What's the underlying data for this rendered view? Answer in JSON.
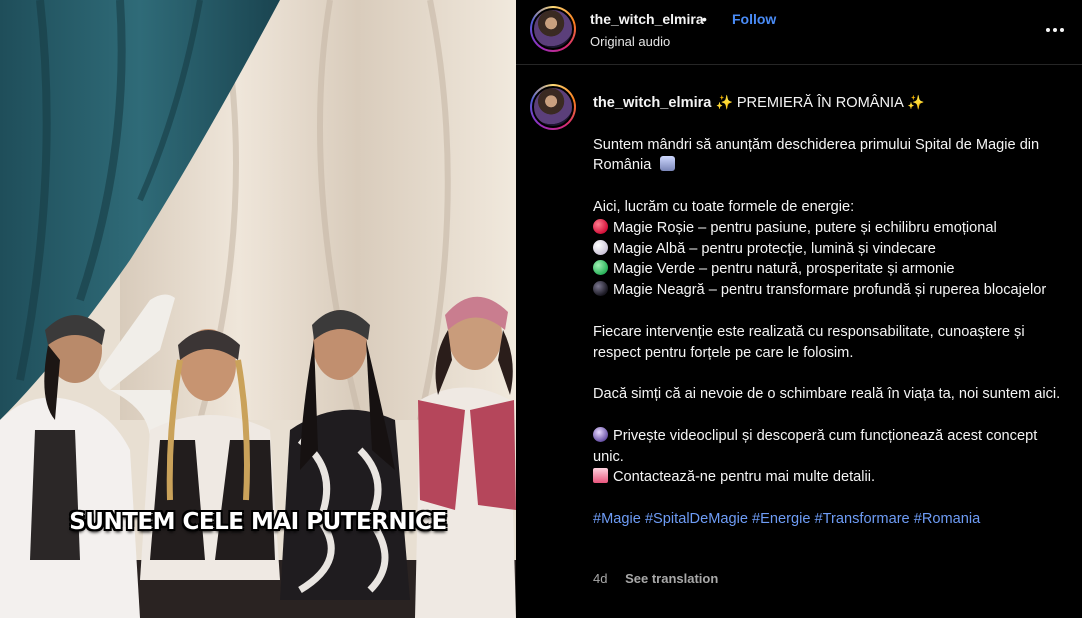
{
  "media": {
    "caption_overlay": "SUNTEM CELE MAI PUTERNICE"
  },
  "header": {
    "username": "the_witch_elmira",
    "separator": "•",
    "follow_label": "Follow",
    "audio_label": "Original audio"
  },
  "comment": {
    "username": "the_witch_elmira",
    "title": "PREMIERĂ ÎN ROMÂNIA",
    "intro": "Suntem mândri să anunțăm deschiderea primului Spital de Magie din România",
    "energies_heading": "Aici, lucrăm cu toate formele de energie:",
    "energies": [
      {
        "icon": "red-circle-icon",
        "text": "Magie Roșie – pentru pasiune, putere și echilibru emoțional"
      },
      {
        "icon": "white-circle-icon",
        "text": "Magie Albă – pentru protecție, lumină și vindecare"
      },
      {
        "icon": "green-circle-icon",
        "text": "Magie Verde – pentru natură, prosperitate și armonie"
      },
      {
        "icon": "black-circle-icon",
        "text": "Magie Neagră – pentru transformare profundă și ruperea blocajelor"
      }
    ],
    "responsibility": "Fiecare intervenție este realizată cu responsabilitate, cunoaștere și respect pentru forțele pe care le folosim.",
    "help": "Dacă simți că ai nevoie de o schimbare reală în viața ta, noi suntem aici.",
    "watch": "Privește videoclipul și descoperă cum funcționează acest concept unic.",
    "contact": "Contactează-ne pentru mai multe detalii.",
    "hashtags": [
      "#Magie",
      "#SpitalDeMagie",
      "#Energie",
      "#Transformare",
      "#Romania"
    ],
    "age": "4d",
    "translate_label": "See translation"
  },
  "colors": {
    "link_blue": "#4a8cf7",
    "hashtag_blue": "#6e9cf5",
    "panel_bg": "#000000",
    "muted_text": "#a8a8a8"
  }
}
